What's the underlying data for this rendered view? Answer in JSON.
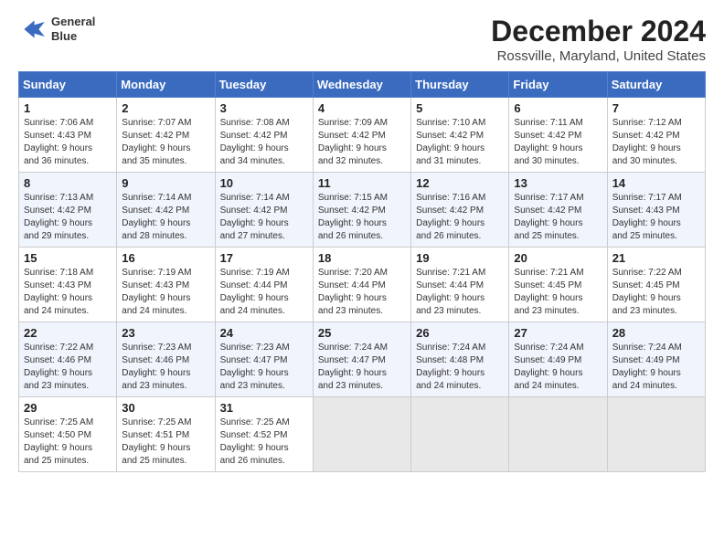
{
  "header": {
    "logo_line1": "General",
    "logo_line2": "Blue",
    "title": "December 2024",
    "location": "Rossville, Maryland, United States"
  },
  "weekdays": [
    "Sunday",
    "Monday",
    "Tuesday",
    "Wednesday",
    "Thursday",
    "Friday",
    "Saturday"
  ],
  "weeks": [
    [
      {
        "day": "1",
        "info": "Sunrise: 7:06 AM\nSunset: 4:43 PM\nDaylight: 9 hours\nand 36 minutes."
      },
      {
        "day": "2",
        "info": "Sunrise: 7:07 AM\nSunset: 4:42 PM\nDaylight: 9 hours\nand 35 minutes."
      },
      {
        "day": "3",
        "info": "Sunrise: 7:08 AM\nSunset: 4:42 PM\nDaylight: 9 hours\nand 34 minutes."
      },
      {
        "day": "4",
        "info": "Sunrise: 7:09 AM\nSunset: 4:42 PM\nDaylight: 9 hours\nand 32 minutes."
      },
      {
        "day": "5",
        "info": "Sunrise: 7:10 AM\nSunset: 4:42 PM\nDaylight: 9 hours\nand 31 minutes."
      },
      {
        "day": "6",
        "info": "Sunrise: 7:11 AM\nSunset: 4:42 PM\nDaylight: 9 hours\nand 30 minutes."
      },
      {
        "day": "7",
        "info": "Sunrise: 7:12 AM\nSunset: 4:42 PM\nDaylight: 9 hours\nand 30 minutes."
      }
    ],
    [
      {
        "day": "8",
        "info": "Sunrise: 7:13 AM\nSunset: 4:42 PM\nDaylight: 9 hours\nand 29 minutes."
      },
      {
        "day": "9",
        "info": "Sunrise: 7:14 AM\nSunset: 4:42 PM\nDaylight: 9 hours\nand 28 minutes."
      },
      {
        "day": "10",
        "info": "Sunrise: 7:14 AM\nSunset: 4:42 PM\nDaylight: 9 hours\nand 27 minutes."
      },
      {
        "day": "11",
        "info": "Sunrise: 7:15 AM\nSunset: 4:42 PM\nDaylight: 9 hours\nand 26 minutes."
      },
      {
        "day": "12",
        "info": "Sunrise: 7:16 AM\nSunset: 4:42 PM\nDaylight: 9 hours\nand 26 minutes."
      },
      {
        "day": "13",
        "info": "Sunrise: 7:17 AM\nSunset: 4:42 PM\nDaylight: 9 hours\nand 25 minutes."
      },
      {
        "day": "14",
        "info": "Sunrise: 7:17 AM\nSunset: 4:43 PM\nDaylight: 9 hours\nand 25 minutes."
      }
    ],
    [
      {
        "day": "15",
        "info": "Sunrise: 7:18 AM\nSunset: 4:43 PM\nDaylight: 9 hours\nand 24 minutes."
      },
      {
        "day": "16",
        "info": "Sunrise: 7:19 AM\nSunset: 4:43 PM\nDaylight: 9 hours\nand 24 minutes."
      },
      {
        "day": "17",
        "info": "Sunrise: 7:19 AM\nSunset: 4:44 PM\nDaylight: 9 hours\nand 24 minutes."
      },
      {
        "day": "18",
        "info": "Sunrise: 7:20 AM\nSunset: 4:44 PM\nDaylight: 9 hours\nand 23 minutes."
      },
      {
        "day": "19",
        "info": "Sunrise: 7:21 AM\nSunset: 4:44 PM\nDaylight: 9 hours\nand 23 minutes."
      },
      {
        "day": "20",
        "info": "Sunrise: 7:21 AM\nSunset: 4:45 PM\nDaylight: 9 hours\nand 23 minutes."
      },
      {
        "day": "21",
        "info": "Sunrise: 7:22 AM\nSunset: 4:45 PM\nDaylight: 9 hours\nand 23 minutes."
      }
    ],
    [
      {
        "day": "22",
        "info": "Sunrise: 7:22 AM\nSunset: 4:46 PM\nDaylight: 9 hours\nand 23 minutes."
      },
      {
        "day": "23",
        "info": "Sunrise: 7:23 AM\nSunset: 4:46 PM\nDaylight: 9 hours\nand 23 minutes."
      },
      {
        "day": "24",
        "info": "Sunrise: 7:23 AM\nSunset: 4:47 PM\nDaylight: 9 hours\nand 23 minutes."
      },
      {
        "day": "25",
        "info": "Sunrise: 7:24 AM\nSunset: 4:47 PM\nDaylight: 9 hours\nand 23 minutes."
      },
      {
        "day": "26",
        "info": "Sunrise: 7:24 AM\nSunset: 4:48 PM\nDaylight: 9 hours\nand 24 minutes."
      },
      {
        "day": "27",
        "info": "Sunrise: 7:24 AM\nSunset: 4:49 PM\nDaylight: 9 hours\nand 24 minutes."
      },
      {
        "day": "28",
        "info": "Sunrise: 7:24 AM\nSunset: 4:49 PM\nDaylight: 9 hours\nand 24 minutes."
      }
    ],
    [
      {
        "day": "29",
        "info": "Sunrise: 7:25 AM\nSunset: 4:50 PM\nDaylight: 9 hours\nand 25 minutes."
      },
      {
        "day": "30",
        "info": "Sunrise: 7:25 AM\nSunset: 4:51 PM\nDaylight: 9 hours\nand 25 minutes."
      },
      {
        "day": "31",
        "info": "Sunrise: 7:25 AM\nSunset: 4:52 PM\nDaylight: 9 hours\nand 26 minutes."
      },
      {
        "day": "",
        "info": ""
      },
      {
        "day": "",
        "info": ""
      },
      {
        "day": "",
        "info": ""
      },
      {
        "day": "",
        "info": ""
      }
    ]
  ]
}
